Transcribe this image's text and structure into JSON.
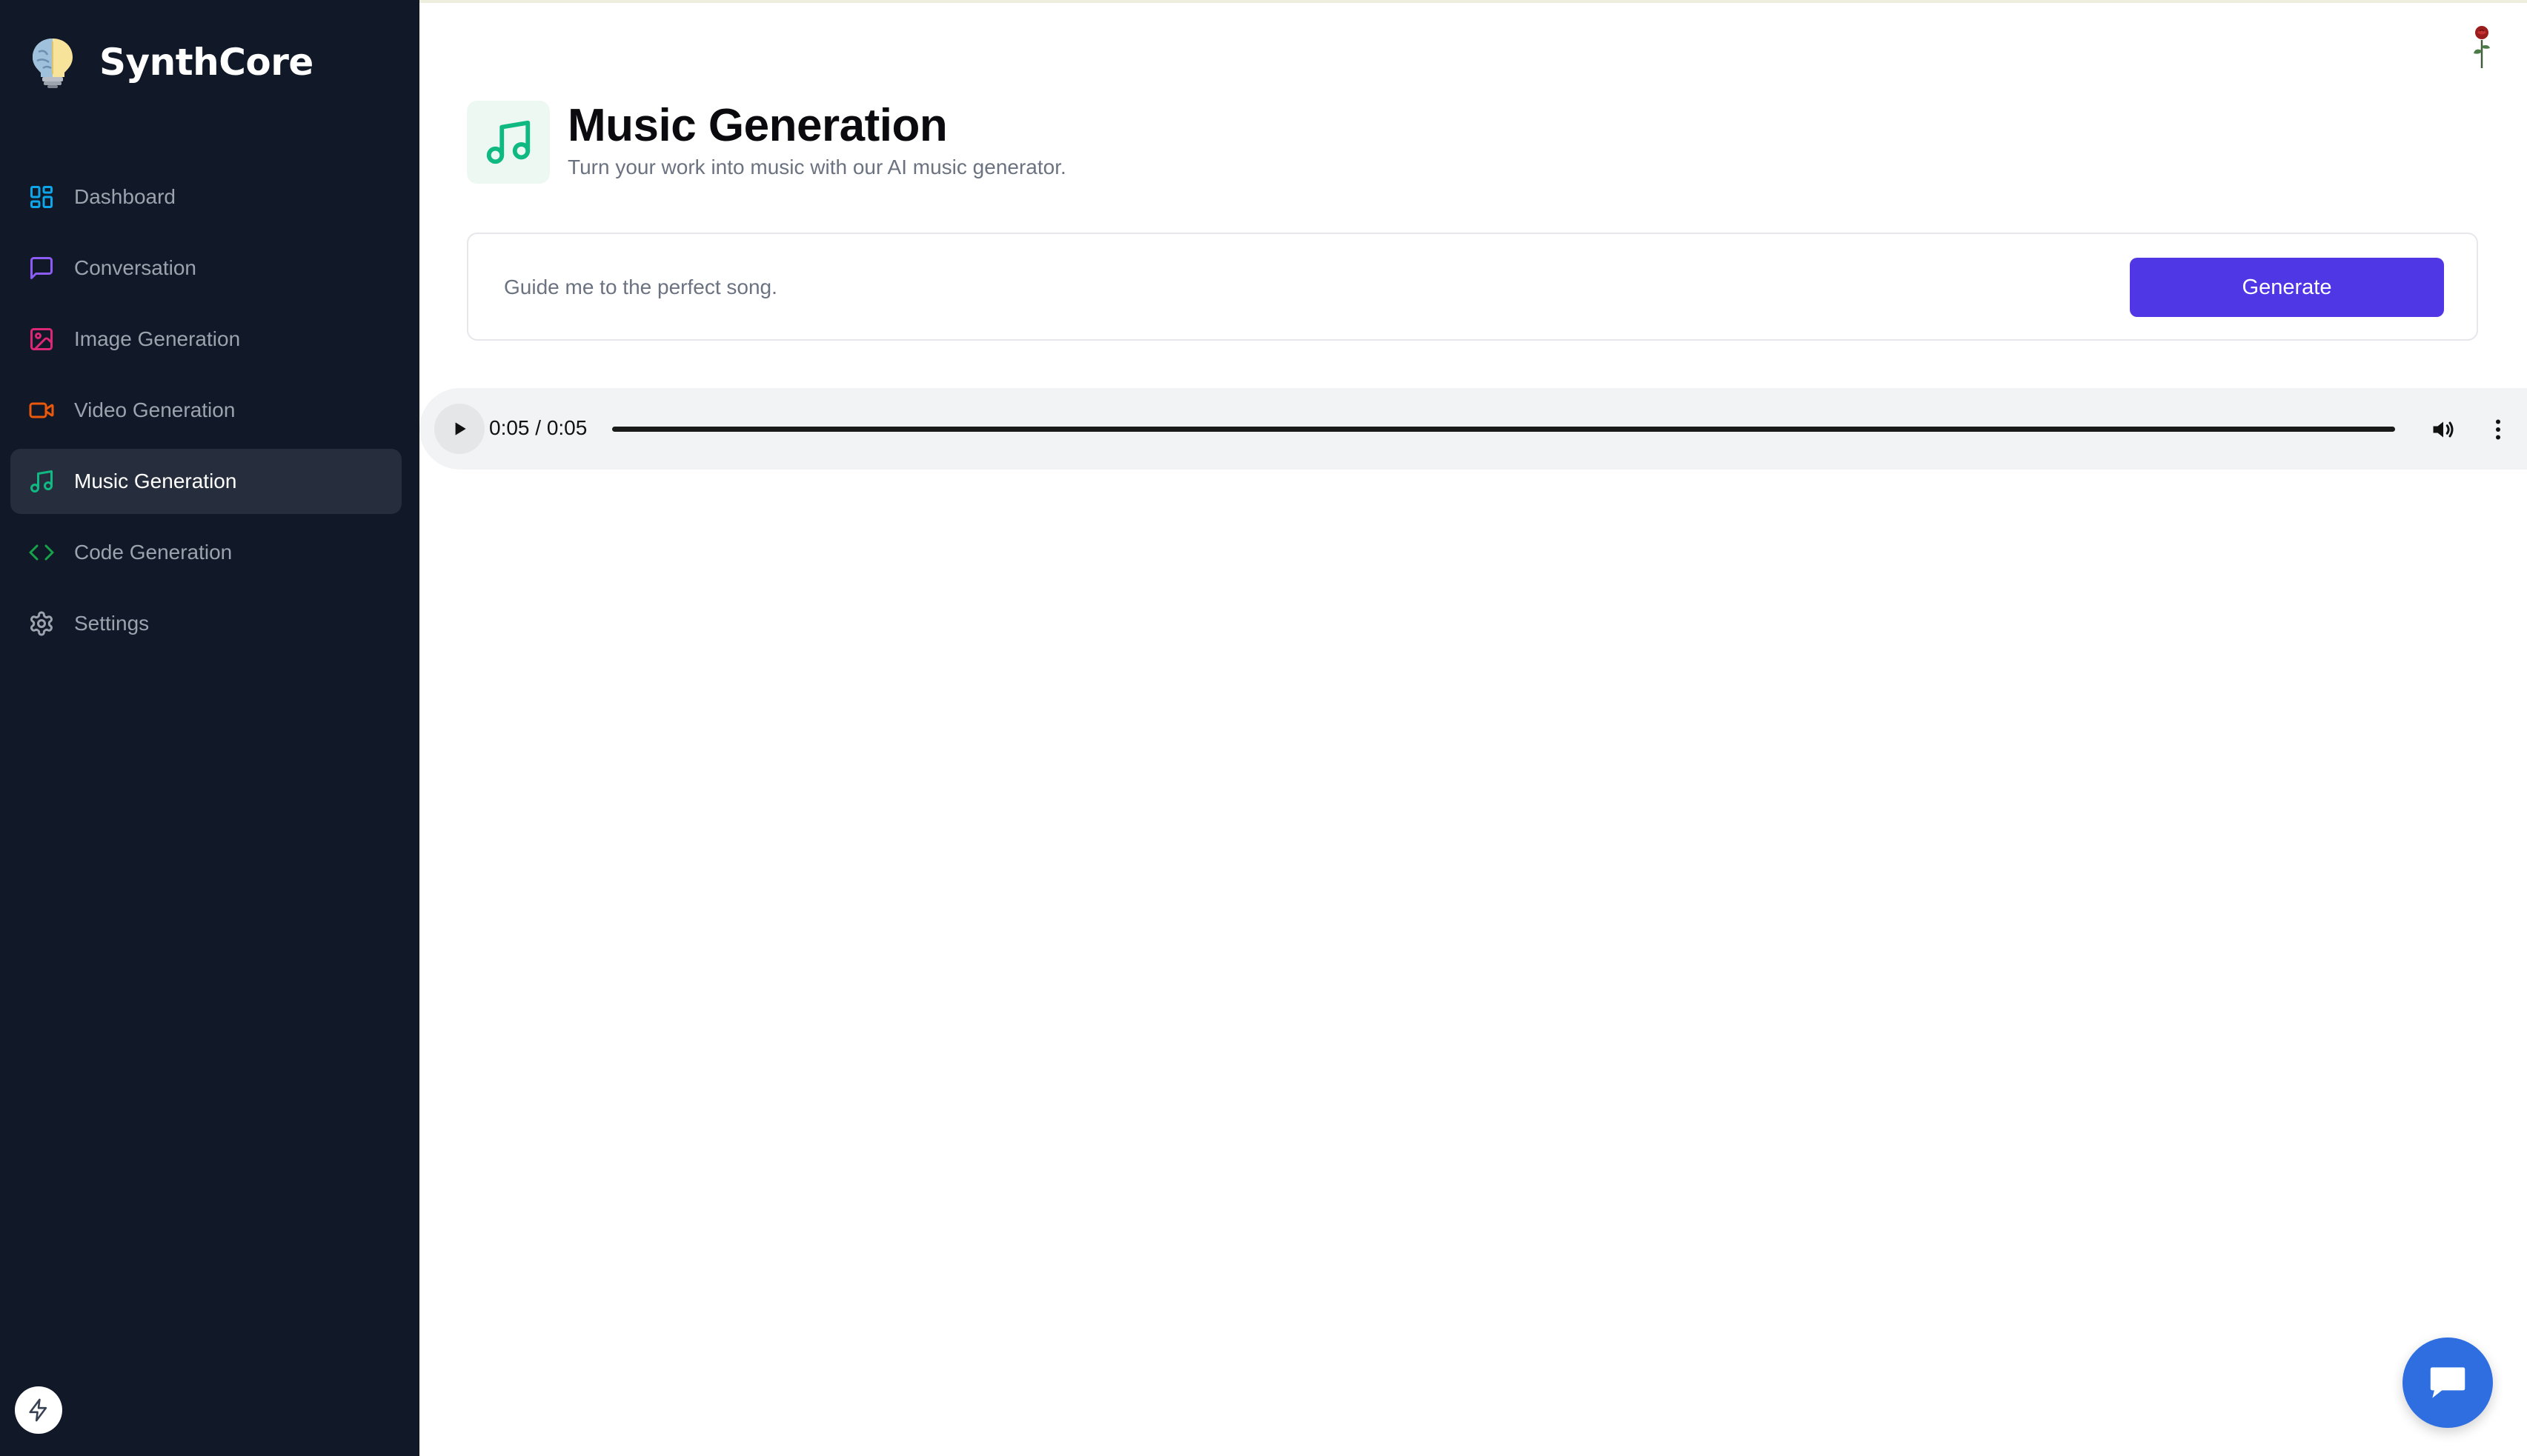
{
  "app": {
    "name": "SynthCore",
    "icons": {
      "logo": "lightbulb-brain-logo",
      "bolt": "bolt-icon",
      "profile": "rose-avatar-icon",
      "chat": "chat-bubble-icon"
    }
  },
  "sidebar": {
    "items": [
      {
        "label": "Dashboard",
        "icon": "layout-dashboard-icon",
        "color": "#0ea5e9",
        "active": false
      },
      {
        "label": "Conversation",
        "icon": "message-square-icon",
        "color": "#8b5cf6",
        "active": false
      },
      {
        "label": "Image Generation",
        "icon": "image-icon",
        "color": "#db2777",
        "active": false
      },
      {
        "label": "Video Generation",
        "icon": "video-icon",
        "color": "#ea580c",
        "active": false
      },
      {
        "label": "Music Generation",
        "icon": "music-icon",
        "color": "#10b981",
        "active": true
      },
      {
        "label": "Code Generation",
        "icon": "code-icon",
        "color": "#16a34a",
        "active": false
      },
      {
        "label": "Settings",
        "icon": "settings-icon",
        "color": "#9ca3af",
        "active": false
      }
    ]
  },
  "header": {
    "title": "Music Generation",
    "subtitle": "Turn your work into music with our AI music generator.",
    "icon": "music-icon",
    "icon_color": "#10b981"
  },
  "prompt": {
    "placeholder": "Guide me to the perfect song.",
    "value": "",
    "button_label": "Generate",
    "button_color": "#4f37e6"
  },
  "audio": {
    "time_display": "0:05 / 0:05",
    "progress_fraction": 1.0
  },
  "colors": {
    "sidebar_bg": "#111827",
    "active_item_bg": "#262e3d",
    "chat_button": "#2e6ee0"
  }
}
